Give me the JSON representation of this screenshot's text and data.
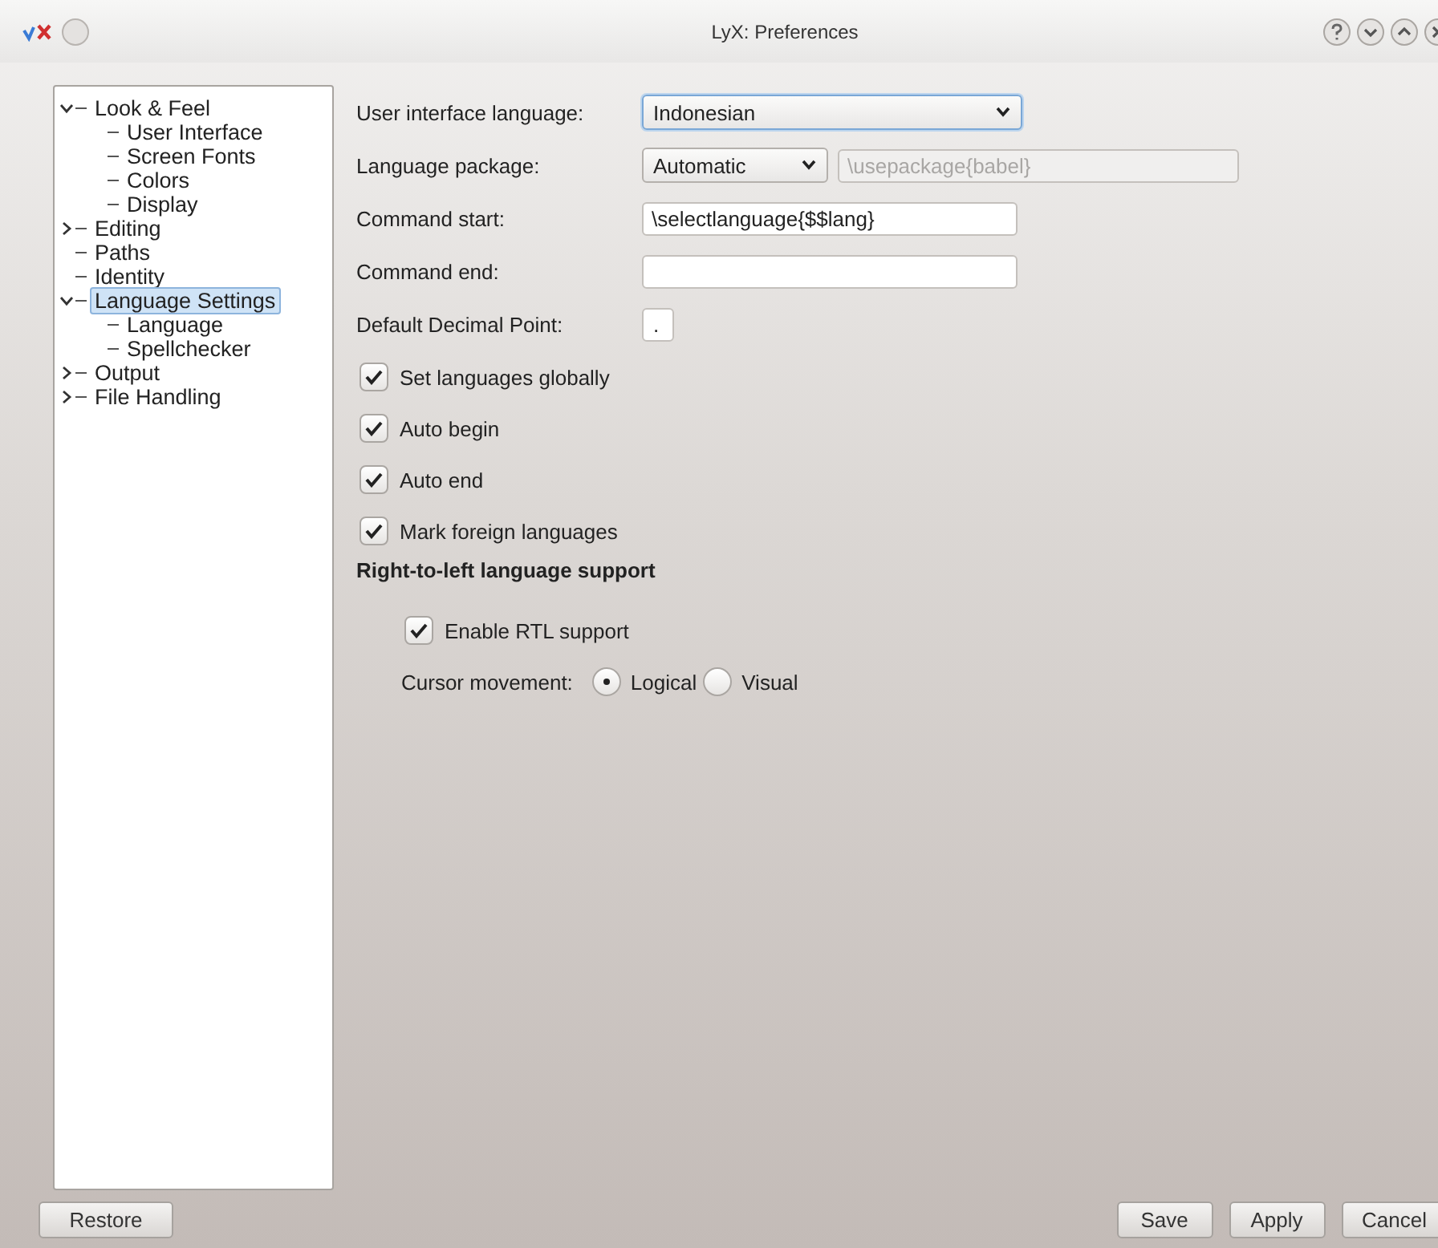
{
  "window": {
    "title": "LyX: Preferences"
  },
  "sidebar": {
    "items": [
      {
        "label": "Look & Feel",
        "selected": false,
        "expanded": true,
        "children": [
          {
            "label": "User Interface",
            "selected": false
          },
          {
            "label": "Screen Fonts",
            "selected": false
          },
          {
            "label": "Colors",
            "selected": false
          },
          {
            "label": "Display",
            "selected": false
          }
        ]
      },
      {
        "label": "Editing",
        "selected": false,
        "expanded": false
      },
      {
        "label": "Paths",
        "selected": false
      },
      {
        "label": "Identity",
        "selected": false
      },
      {
        "label": "Language Settings",
        "selected": true,
        "expanded": true,
        "children": [
          {
            "label": "Language",
            "selected": false
          },
          {
            "label": "Spellchecker",
            "selected": false
          }
        ]
      },
      {
        "label": "Output",
        "selected": false,
        "expanded": false
      },
      {
        "label": "File Handling",
        "selected": false,
        "expanded": false
      }
    ]
  },
  "form": {
    "fields": [
      {
        "kind": "select",
        "label": "User interface language:",
        "value": "Indonesian",
        "focused": true
      },
      {
        "kind": "select_with_field",
        "label": "Language package:",
        "value": "Automatic",
        "extra_value": "\\usepackage{babel}",
        "extra_disabled": true
      },
      {
        "kind": "text",
        "label": "Command start:",
        "value": "\\selectlanguage{$$lang}"
      },
      {
        "kind": "text",
        "label": "Command end:"
      },
      {
        "kind": "short_text",
        "label": "Default Decimal Point:",
        "value": "."
      }
    ],
    "checkboxes": [
      {
        "label": "Set languages globally",
        "checked": true
      },
      {
        "label": "Auto begin",
        "checked": true
      },
      {
        "label": "Auto end",
        "checked": true
      },
      {
        "label": "Mark foreign languages",
        "checked": true
      }
    ],
    "rtl": {
      "heading": "Right-to-left language support",
      "checkbox": {
        "label": "Enable RTL support",
        "checked": true
      },
      "cursor_movement": {
        "label": "Cursor movement:",
        "options": [
          {
            "label": "Logical",
            "selected": true
          },
          {
            "label": "Visual",
            "selected": false
          }
        ]
      }
    }
  },
  "buttons": {
    "left": [
      "Restore"
    ],
    "right": [
      "Save",
      "Apply",
      "Cancel"
    ]
  }
}
